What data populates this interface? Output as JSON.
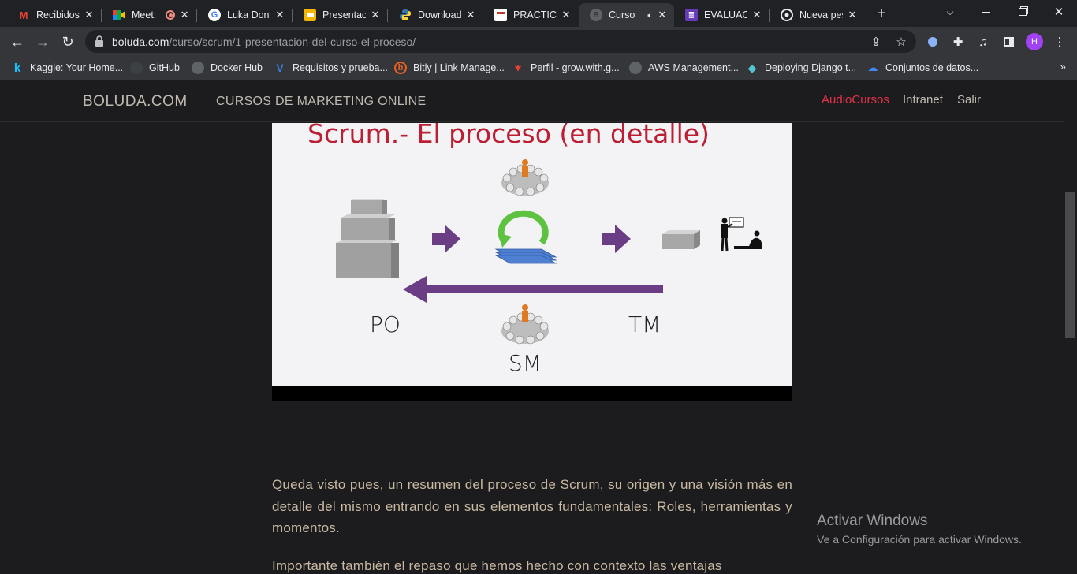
{
  "tabs": [
    {
      "title": "Recibidos",
      "favicon": "gmail-icon",
      "color": "#ea4335",
      "glyph": "M"
    },
    {
      "title": "Meet:",
      "favicon": "meet-icon",
      "color": "#00ac47",
      "glyph": "▶"
    },
    {
      "title": "Luka Donč",
      "favicon": "google-icon",
      "color": "#4285f4",
      "glyph": "G"
    },
    {
      "title": "Presentaci",
      "favicon": "slides-icon",
      "color": "#f4b400",
      "glyph": "▭"
    },
    {
      "title": "Download",
      "favicon": "python-icon",
      "color": "#3776ab",
      "glyph": "⟁"
    },
    {
      "title": "PRACTICA",
      "favicon": "practica-icon",
      "color": "#c0392b",
      "glyph": "▦"
    },
    {
      "title": "Curso",
      "favicon": "boluda-icon",
      "color": "#777777",
      "glyph": "B"
    },
    {
      "title": "EVALUACIC",
      "favicon": "forms-icon",
      "color": "#673ab7",
      "glyph": "≣"
    },
    {
      "title": "Nueva pes",
      "favicon": "chrome-icon",
      "color": "#bdc1c6",
      "glyph": "◉"
    }
  ],
  "toolbar": {
    "url_host": "boluda.com",
    "url_path": "/curso/scrum/1-presentacion-del-curso-el-proceso/",
    "avatar_letter": "H"
  },
  "bookmarks": [
    {
      "label": "Kaggle: Your Home...",
      "icon": "kaggle-icon",
      "color": "#20beff",
      "glyph": "k"
    },
    {
      "label": "GitHub",
      "icon": "github-icon",
      "color": "#24292e",
      "glyph": "◍"
    },
    {
      "label": "Docker Hub",
      "icon": "docker-icon",
      "color": "#5f6368",
      "glyph": "◍"
    },
    {
      "label": "Requisitos y prueba...",
      "icon": "vue-icon",
      "color": "#3f7bd8",
      "glyph": "V"
    },
    {
      "label": "Bitly | Link Manage...",
      "icon": "bitly-icon",
      "color": "#ee6123",
      "glyph": "b"
    },
    {
      "label": "Perfil - grow.with.g...",
      "icon": "grow-icon",
      "color": "#ea4335",
      "glyph": "✱"
    },
    {
      "label": "AWS Management...",
      "icon": "aws-icon",
      "color": "#5f6368",
      "glyph": "◍"
    },
    {
      "label": "Deploying Django t...",
      "icon": "cube-icon",
      "color": "#54c5d0",
      "glyph": "◆"
    },
    {
      "label": "Conjuntos de datos...",
      "icon": "gcloud-icon",
      "color": "#4285f4",
      "glyph": "☁"
    }
  ],
  "site": {
    "brand": "BOLUDA.COM",
    "tagline": "CURSOS DE MARKETING ONLINE",
    "nav": [
      "AudioCursos",
      "Intranet",
      "Salir"
    ]
  },
  "slide": {
    "title": "Scrum.- El proceso (en detalle)",
    "labels": {
      "po": "PO",
      "tm": "TM",
      "sm": "SM"
    }
  },
  "content": {
    "para1": "Queda visto pues, un resumen del proceso de Scrum, su origen y una visión más en detalle del mismo entrando en sus elementos fundamentales: Roles, herramientas y momentos.",
    "para2": "Importante también el repaso que hemos hecho con contexto las ventajas"
  },
  "watermark": {
    "title": "Activar Windows",
    "subtitle": "Ve a Configuración para activar Windows."
  }
}
